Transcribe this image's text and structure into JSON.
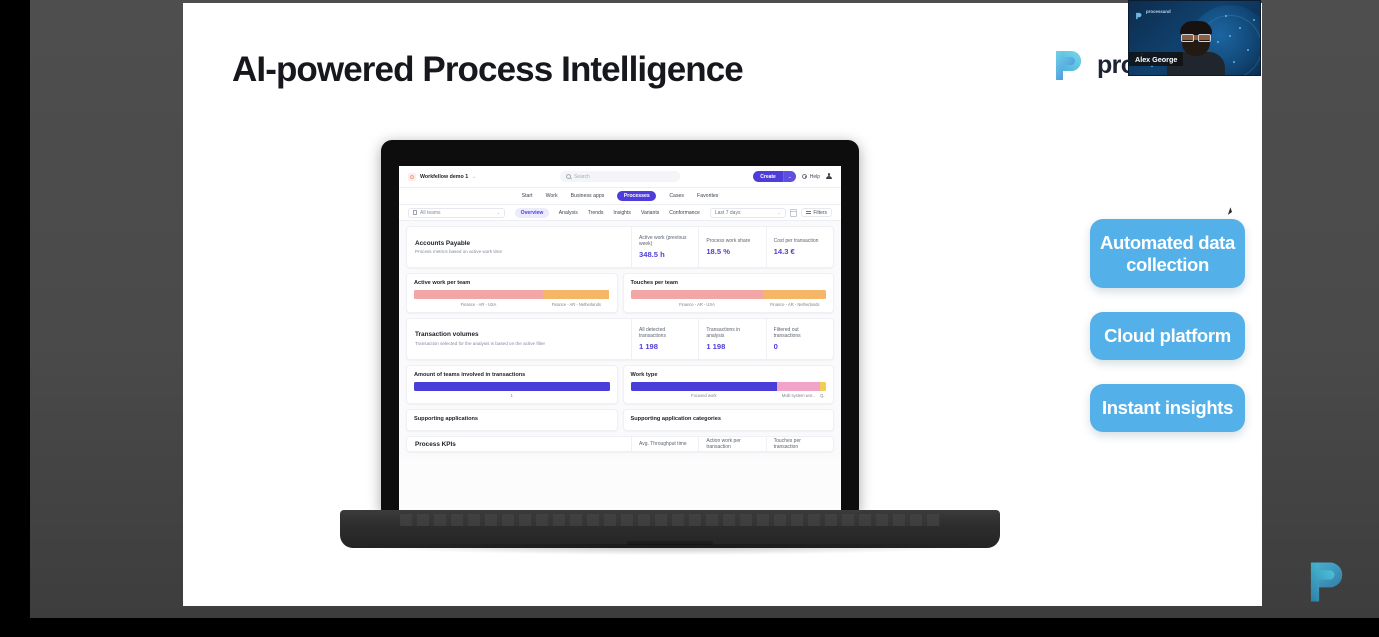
{
  "slide": {
    "title": "AI-powered Process Intelligence",
    "brand_word": "proc",
    "brand_full": "processand"
  },
  "video": {
    "presenter_name": "Alex George",
    "logo_text": "processand"
  },
  "pills": [
    {
      "label": "Automated data collection"
    },
    {
      "label": "Cloud platform"
    },
    {
      "label": "Instant insights"
    }
  ],
  "app": {
    "topbar": {
      "workspace": "Workfellow demo 1",
      "workspace_caret": "⌄",
      "search_placeholder": "Search",
      "create_label": "Create",
      "create_caret": "⌄",
      "help_label": "Help"
    },
    "nav": {
      "items": [
        {
          "label": "Start",
          "active": false
        },
        {
          "label": "Work",
          "active": false
        },
        {
          "label": "Business apps",
          "active": false
        },
        {
          "label": "Processes",
          "active": true
        },
        {
          "label": "Cases",
          "active": false
        },
        {
          "label": "Favorites",
          "active": false
        }
      ]
    },
    "filters": {
      "team_select": "All teams",
      "team_caret": "⌄",
      "subnav": [
        {
          "label": "Overview",
          "active": true
        },
        {
          "label": "Analysis",
          "active": false
        },
        {
          "label": "Trends",
          "active": false
        },
        {
          "label": "Insights",
          "active": false
        },
        {
          "label": "Variants",
          "active": false
        },
        {
          "label": "Conformance",
          "active": false
        }
      ],
      "date_range": "Last 7 days",
      "date_caret": "⌄",
      "filters_label": "Filters"
    },
    "accounts_payable": {
      "title": "Accounts Payable",
      "subtitle": "Process metrics based on active work time",
      "metrics": [
        {
          "label": "Active work (previous week)",
          "value": "348.5 h"
        },
        {
          "label": "Process work share",
          "value": "18.5 %"
        },
        {
          "label": "Cost per transaction",
          "value": "14.3 €"
        }
      ]
    },
    "active_work_per_team": {
      "title": "Active work per team",
      "segments": [
        {
          "label": "Finance - AR - USA",
          "pct": 66,
          "color": "#f2a6a6"
        },
        {
          "label": "Finance - AR - Netherlands",
          "pct": 34,
          "color": "#f5b668"
        }
      ]
    },
    "touches_per_team": {
      "title": "Touches per team",
      "segments": [
        {
          "label": "Finance - AR - USA",
          "pct": 68,
          "color": "#f2a6a6"
        },
        {
          "label": "Finance - AR - Netherlands",
          "pct": 32,
          "color": "#f5b668"
        }
      ]
    },
    "transaction_volumes": {
      "title": "Transaction volumes",
      "subtitle": "Transaction selected for the analysis is based on the active filter",
      "metrics": [
        {
          "label": "All detected transactions",
          "value": "1 198"
        },
        {
          "label": "Transactions in analysis",
          "value": "1 198"
        },
        {
          "label": "Filtered out transactions",
          "value": "0"
        }
      ]
    },
    "teams_involved": {
      "title": "Amount of teams involved in transactions",
      "segments": [
        {
          "label": "1",
          "pct": 100,
          "color": "#4a3ed8"
        }
      ]
    },
    "work_type": {
      "title": "Work type",
      "segments": [
        {
          "label": "Focused work",
          "pct": 75,
          "color": "#4a3ed8"
        },
        {
          "label": "Multi system wor...",
          "pct": 22,
          "color": "#f0a5c8"
        },
        {
          "label": "Q...",
          "pct": 3,
          "color": "#f2cc55"
        }
      ]
    },
    "supporting_applications": {
      "title": "Supporting applications"
    },
    "supporting_application_categories": {
      "title": "Supporting application categories"
    },
    "process_kpis": {
      "title": "Process KPIs",
      "metrics": [
        {
          "label": "Avg. Throughput time"
        },
        {
          "label": "Action work per transaction"
        },
        {
          "label": "Touches per transaction"
        }
      ]
    }
  },
  "colors": {
    "accent_purple": "#4e3ddb",
    "pill_blue": "#54b0e8",
    "slide_bg": "#ffffff",
    "player_bg": "#4e4e4e",
    "brand_teal": "#3fb8d4"
  }
}
